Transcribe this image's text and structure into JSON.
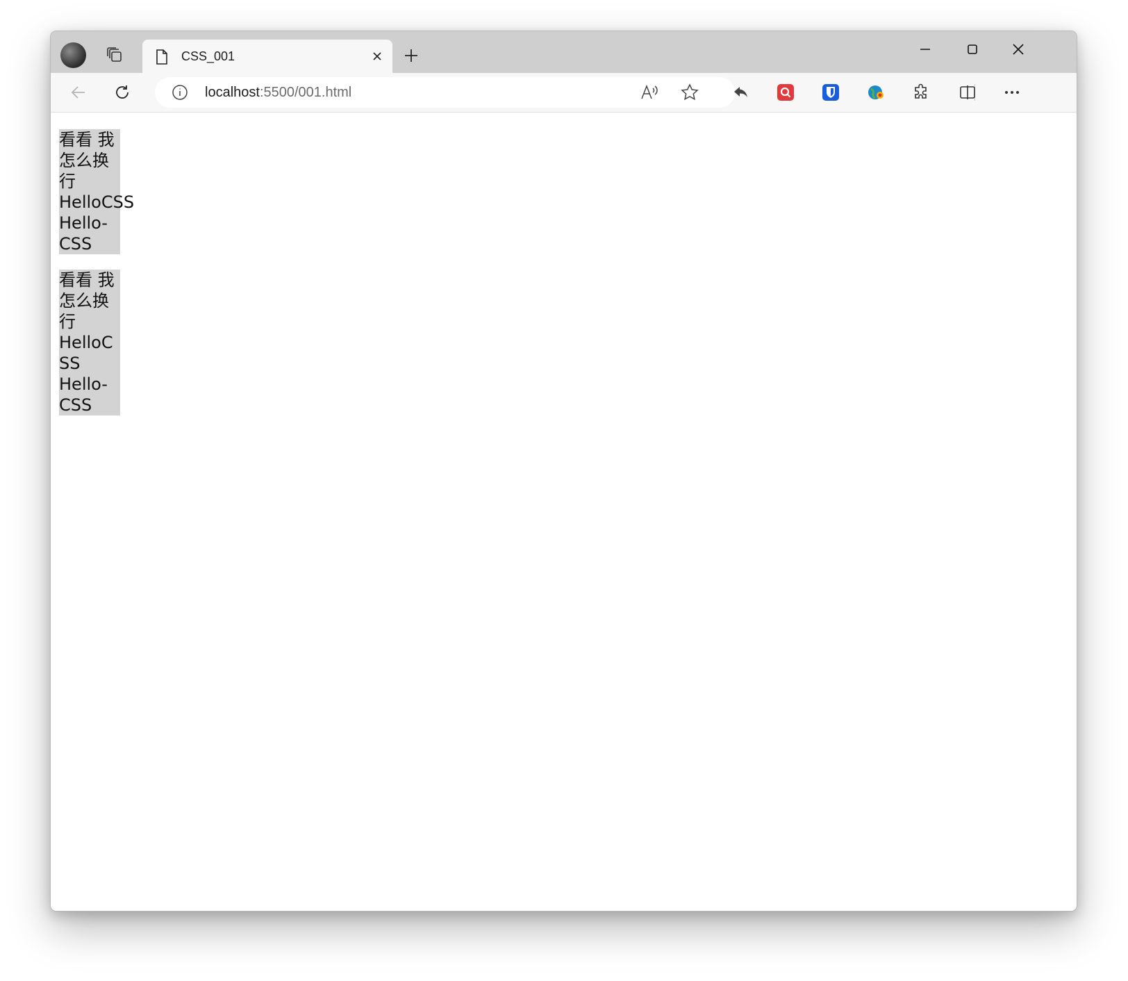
{
  "tab": {
    "title": "CSS_001"
  },
  "address": {
    "host": "localhost",
    "rest": ":5500/001.html"
  },
  "content": {
    "box1": [
      "看看 我",
      "怎么换",
      "行",
      "HelloCSS",
      "Hello-",
      "CSS"
    ],
    "box2": [
      "看看 我",
      "怎么换",
      "行",
      "HelloC",
      "SS",
      "Hello-",
      "CSS"
    ]
  },
  "colors": {
    "titlebar": "#cfcfcf",
    "toolbar": "#f7f7f7",
    "box": "#d3d3d3"
  },
  "icons": [
    "profile-avatar",
    "tab-actions-icon",
    "document-icon",
    "close-icon",
    "plus-icon",
    "minimize-icon",
    "maximize-icon",
    "back-icon",
    "refresh-icon",
    "info-icon",
    "read-aloud-icon",
    "favorite-star-icon",
    "share-back-icon",
    "search-extension-icon",
    "bitwarden-icon",
    "globe-extension-icon",
    "extensions-puzzle-icon",
    "split-screen-icon",
    "more-icon"
  ]
}
